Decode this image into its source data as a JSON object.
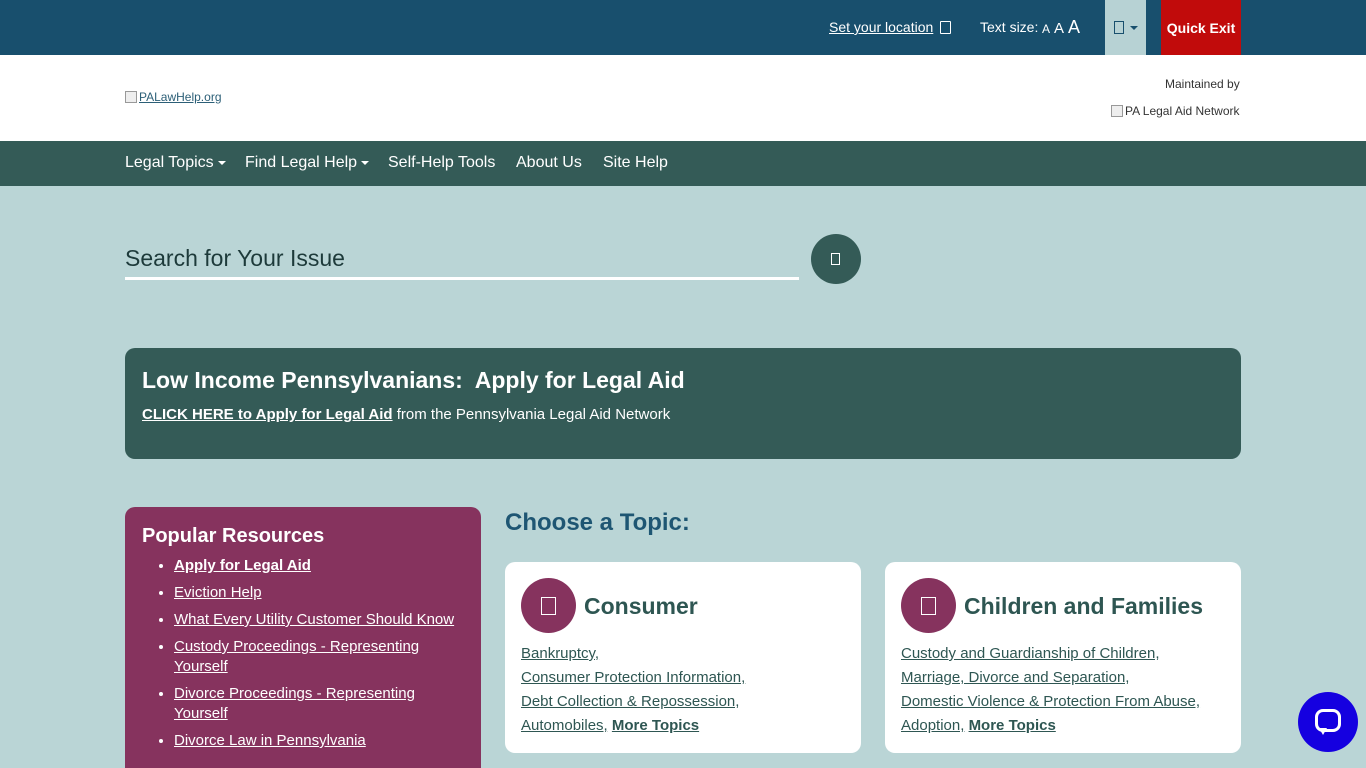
{
  "topbar": {
    "location_label": "Set your location",
    "text_size_label": "Text size:",
    "text_sizes": [
      "A",
      "A",
      "A"
    ],
    "quick_exit": "Quick Exit"
  },
  "header": {
    "logo_alt": "PALawHelp.org",
    "maintained_by": "Maintained by",
    "network_alt": "PA Legal Aid Network"
  },
  "nav": {
    "items": [
      {
        "label": "Legal Topics"
      },
      {
        "label": "Find Legal Help"
      },
      {
        "label": "Self-Help Tools"
      },
      {
        "label": "About Us"
      },
      {
        "label": "Site Help"
      }
    ]
  },
  "search": {
    "label": "Search for Your Issue"
  },
  "banner": {
    "title": "Low Income Pennsylvanians:  Apply for Legal Aid",
    "link": "CLICK HERE to Apply for Legal Aid",
    "suffix": " from the Pennsylvania Legal Aid Network"
  },
  "popular": {
    "title": "Popular Resources",
    "items": [
      "Apply for Legal Aid",
      "Eviction Help",
      "What Every Utility Customer Should Know",
      "Custody Proceedings - Representing Yourself",
      "Divorce Proceedings - Representing Yourself",
      "Divorce Law in Pennsylvania"
    ]
  },
  "topics": {
    "title": "Choose a Topic:",
    "cards": [
      {
        "title": "Consumer",
        "links": [
          "Bankruptcy,",
          "Consumer Protection Information,",
          "Debt Collection & Repossession,",
          "Automobiles,"
        ],
        "more": "More Topics"
      },
      {
        "title": "Children and Families",
        "links": [
          "Custody and Guardianship of Children,",
          "Marriage, Divorce and Separation,",
          "Domestic Violence & Protection From Abuse,",
          "Adoption,"
        ],
        "more": "More Topics"
      }
    ]
  },
  "colors": {
    "topbar": "#184f6d",
    "nav": "#345b57",
    "page_bg": "#bad5d6",
    "accent_magenta": "#86335e",
    "quick_exit": "#c10b0b",
    "chat": "#1500e0"
  }
}
